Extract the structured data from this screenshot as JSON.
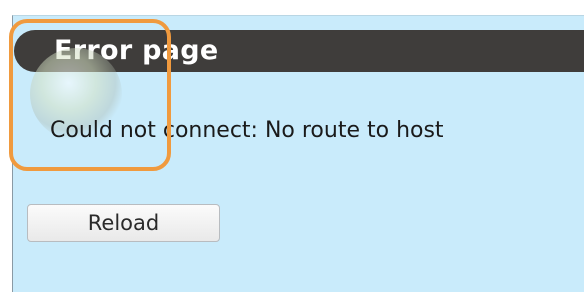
{
  "error_page": {
    "title": "Error page",
    "message": "Could not connect: No route to host",
    "reload_label": "Reload"
  },
  "icons": {
    "error_icon": "error-globe-icon"
  },
  "colors": {
    "background": "#c9ebfb",
    "header": "#3f3d3b",
    "highlight": "#f09a3e"
  }
}
